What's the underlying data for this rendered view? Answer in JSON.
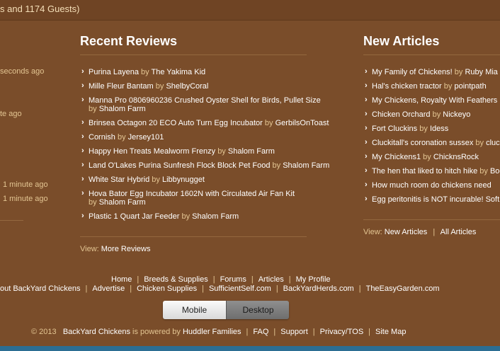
{
  "top": {
    "guests_text": "s and 1174 Guests)"
  },
  "left_col": {
    "entries": [
      "seconds ago",
      "te ago",
      "1 minute ago",
      "1 minute ago"
    ]
  },
  "reviews": {
    "title": "Recent Reviews",
    "by_word": "by",
    "items": [
      {
        "title": "Purina Layena",
        "author": "The Yakima Kid"
      },
      {
        "title": "Mille Fleur Bantam",
        "author": "ShelbyCoral"
      },
      {
        "title": "Manna Pro 0806960236 Crushed Oyster Shell for Birds, Pullet Size",
        "author": "Shalom Farm"
      },
      {
        "title": "Brinsea Octagon 20 ECO Auto Turn Egg Incubator",
        "author": "GerbilsOnToast"
      },
      {
        "title": "Cornish",
        "author": "Jersey101"
      },
      {
        "title": "Happy Hen Treats Mealworm Frenzy",
        "author": "Shalom Farm"
      },
      {
        "title": "Land O'Lakes Purina Sunfresh Flock Block Pet Food",
        "author": "Shalom Farm"
      },
      {
        "title": "White Star Hybrid",
        "author": "Libbynugget"
      },
      {
        "title": "Hova Bator Egg Incubator 1602N with Circulated Air Fan Kit",
        "author": "Shalom Farm"
      },
      {
        "title": "Plastic 1 Quart Jar Feeder",
        "author": "Shalom Farm"
      }
    ],
    "view_label": "View:",
    "more_link": "More Reviews"
  },
  "articles": {
    "title": "New Articles",
    "by_word": "by",
    "items": [
      {
        "title": "My Family of Chickens!",
        "author": "Ruby Mia"
      },
      {
        "title": "Hal's chicken tractor",
        "author": "pointpath"
      },
      {
        "title": "My Chickens, Royalty With Feathers",
        "author": ""
      },
      {
        "title": "Chicken Orchard",
        "author": "Nickeyo"
      },
      {
        "title": "Fort Cluckins",
        "author": "Idess"
      },
      {
        "title": "Cluckitall's coronation sussex",
        "author": "cluc"
      },
      {
        "title": "My Chickens1",
        "author": "ChicknsRock"
      },
      {
        "title": "The hen that liked to hitch hike",
        "author": "Boo"
      },
      {
        "title": "How much room do chickens need",
        "author": ""
      },
      {
        "title": "Egg peritonitis is NOT incurable! Soft.",
        "author": ""
      }
    ],
    "view_label": "View:",
    "new_link": "New Articles",
    "all_link": "All Articles"
  },
  "footer": {
    "row1": [
      "Home",
      "Breeds & Supplies",
      "Forums",
      "Articles",
      "My Profile"
    ],
    "row2": [
      "out BackYard Chickens",
      "Advertise",
      "Chicken Supplies",
      "SufficientSelf.com",
      "BackYardHerds.com",
      "TheEasyGarden.com"
    ],
    "toggle": {
      "mobile": "Mobile",
      "desktop": "Desktop"
    },
    "copyright": "© 2013",
    "site_name": "BackYard Chickens",
    "powered_by": "is powered by",
    "huddler": "Huddler Families",
    "links": [
      "FAQ",
      "Support",
      "Privacy/TOS",
      "Site Map"
    ]
  },
  "colors": {
    "background": "#7a4d2a",
    "muted_text": "#e3c592",
    "bottom_bar": "#2c6e93"
  }
}
